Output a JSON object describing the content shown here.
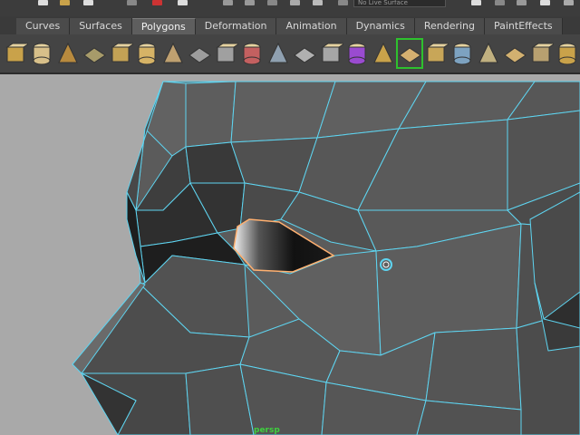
{
  "topbar": {
    "input_placeholder": "No Live Surface"
  },
  "shelf": {
    "tabs": [
      {
        "label": "Curves",
        "active": false
      },
      {
        "label": "Surfaces",
        "active": false
      },
      {
        "label": "Polygons",
        "active": true
      },
      {
        "label": "Deformation",
        "active": false
      },
      {
        "label": "Animation",
        "active": false
      },
      {
        "label": "Dynamics",
        "active": false
      },
      {
        "label": "Rendering",
        "active": false
      },
      {
        "label": "PaintEffects",
        "active": false
      }
    ],
    "tools": [
      "poly-cube-icon",
      "poly-cylinder-icon",
      "poly-cone-icon",
      "poly-plane-icon",
      "poly-torus-icon",
      "poly-pyramid-icon",
      "poly-pipe-icon",
      "poly-soccer-ball-icon",
      "combine-icon",
      "separate-icon",
      "boolean-union-icon",
      "smooth-icon",
      "poly-sphere-icon",
      "select-cube-icon",
      "extrude-icon",
      "split-polygon-icon",
      "append-polygon-icon",
      "merge-icon",
      "subdivide-icon",
      "wedge-icon",
      "texture-editor-icon",
      "unfold-icon"
    ],
    "selected_tool_index": 15
  },
  "viewport": {
    "camera": "persp"
  },
  "colors": {
    "wire": "#5ed4f0",
    "selection": "#ffb070",
    "mesh_base": "#5a5a5a",
    "background": "#a9a9a9"
  }
}
